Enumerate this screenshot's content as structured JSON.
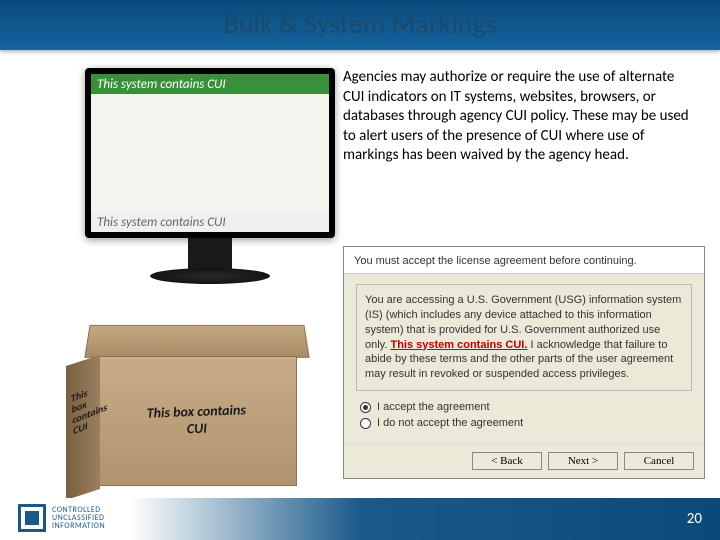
{
  "header": {
    "title": "Bulk & System Markings"
  },
  "monitor": {
    "top_banner": "This system contains CUI",
    "bottom_banner": "This system contains CUI"
  },
  "box": {
    "side_text": "This box contains CUI",
    "front_text_line1": "This box contains",
    "front_text_line2": "CUI"
  },
  "body_text": "Agencies may authorize or require the use of alternate CUI indicators on IT systems, websites, browsers, or databases through agency CUI policy. These may be used to alert users of the presence of CUI where use of markings has been waived by the agency head.",
  "dialog": {
    "instruction": "You must accept the license agreement before continuing.",
    "para_before": "You are accessing a U.S. Government (USG) information system (IS) (which includes any device attached to this information system) that is provided for U.S. Government authorized use only. ",
    "highlight": "This system contains CUI.",
    "para_after": " I acknowledge that failure to abide by these terms and the other parts of the user agreement may result in revoked or suspended access privileges.",
    "opt_accept": "I accept the agreement",
    "opt_reject": "I do not accept the agreement",
    "btn_back": "< Back",
    "btn_next": "Next >",
    "btn_cancel": "Cancel"
  },
  "footer": {
    "logo_line1": "CONTROLLED",
    "logo_line2": "UNCLASSIFIED",
    "logo_line3": "INFORMATION",
    "page_number": "20"
  }
}
